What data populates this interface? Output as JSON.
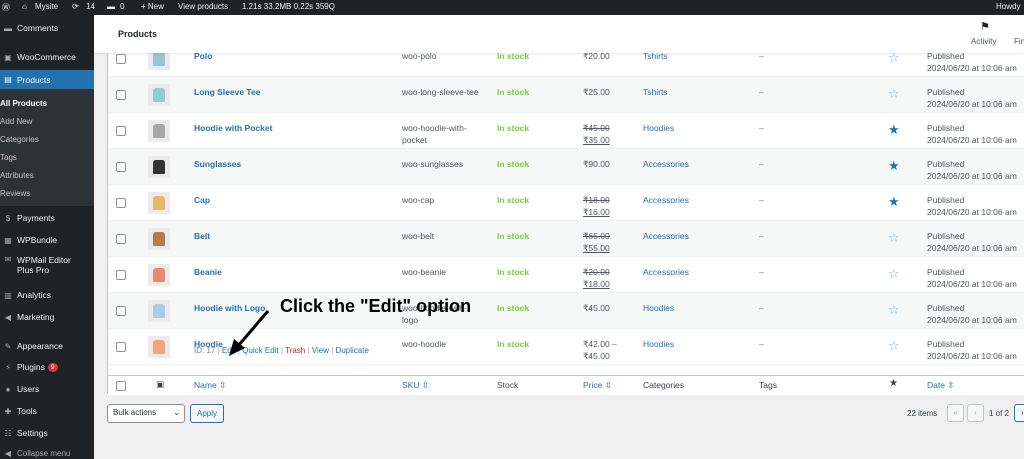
{
  "admin_bar": {
    "site_name": "Mysite",
    "updates_count": "14",
    "comments_count": "0",
    "new_label": "+ New",
    "view_products": "View products",
    "stats": "1.21s  33.2MB  0.22s  359Q",
    "howdy": "Howdy"
  },
  "sidebar": {
    "comments": "Comments",
    "woocommerce": "WooCommerce",
    "products": "Products",
    "sub_items": [
      "All Products",
      "Add New",
      "Categories",
      "Tags",
      "Attributes",
      "Reviews"
    ],
    "payments": "Payments",
    "wpbundle": "WPBundle",
    "wpmail_line1": "WPMail Editor",
    "wpmail_line2": "Plus Pro",
    "analytics": "Analytics",
    "marketing": "Marketing",
    "appearance": "Appearance",
    "plugins": "Plugins",
    "plugins_badge": "9",
    "users": "Users",
    "tools": "Tools",
    "settings": "Settings",
    "collapse": "Collapse menu"
  },
  "header": {
    "title": "Products",
    "activity": "Activity",
    "finish": "Fin"
  },
  "rows": [
    {
      "name": "Polo",
      "sku": "woo-polo",
      "stock": "In stock",
      "price_old": "",
      "price": "₹20.00",
      "category": "Tshirts",
      "tags": "–",
      "featured": false,
      "status": "Published",
      "date": "2024/06/20 at 10:06 am",
      "color": "#9cc3d8"
    },
    {
      "name": "Long Sleeve Tee",
      "sku": "woo-long-sleeve-tee",
      "stock": "In stock",
      "price_old": "",
      "price": "₹25.00",
      "category": "Tshirts",
      "tags": "–",
      "featured": false,
      "status": "Published",
      "date": "2024/06/20 at 10:06 am",
      "color": "#8fd0c2"
    },
    {
      "name": "Hoodie with Pocket",
      "sku": "woo-hoodie-with-pocket",
      "stock": "In stock",
      "price_old": "₹45.00",
      "price": "₹35.00",
      "category": "Hoodies",
      "tags": "–",
      "featured": true,
      "status": "Published",
      "date": "2024/06/20 at 10:06 am",
      "color": "#a8a8a8"
    },
    {
      "name": "Sunglasses",
      "sku": "woo-sunglasses",
      "stock": "In stock",
      "price_old": "",
      "price": "₹90.00",
      "category": "Accessories",
      "tags": "–",
      "featured": true,
      "status": "Published",
      "date": "2024/06/20 at 10:06 am",
      "color": "#333333"
    },
    {
      "name": "Cap",
      "sku": "woo-cap",
      "stock": "In stock",
      "price_old": "₹18.00",
      "price": "₹16.00",
      "category": "Accessories",
      "tags": "–",
      "featured": true,
      "status": "Published",
      "date": "2024/06/20 at 10:06 am",
      "color": "#e8b86a"
    },
    {
      "name": "Belt",
      "sku": "woo-belt",
      "stock": "In stock",
      "price_old": "₹65.00",
      "price": "₹55.00",
      "category": "Accessories",
      "tags": "–",
      "featured": false,
      "status": "Published",
      "date": "2024/06/20 at 10:06 am",
      "color": "#b87a4b"
    },
    {
      "name": "Beanie",
      "sku": "woo-beanie",
      "stock": "In stock",
      "price_old": "₹20.00",
      "price": "₹18.00",
      "category": "Accessories",
      "tags": "–",
      "featured": false,
      "status": "Published",
      "date": "2024/06/20 at 10:06 am",
      "color": "#e88a72"
    },
    {
      "name": "Hoodie with Logo",
      "sku": "woo-hoodie-with-logo",
      "stock": "In stock",
      "price_old": "",
      "price": "₹45.00",
      "category": "Hoodies",
      "tags": "–",
      "featured": false,
      "status": "Published",
      "date": "2024/06/20 at 10:06 am",
      "color": "#a9cde6"
    },
    {
      "name": "Hoodie",
      "sku": "woo-hoodie",
      "stock": "In stock",
      "price_old": "",
      "price": "₹42.00 –\n₹45.00",
      "category": "Hoodies",
      "tags": "–",
      "featured": false,
      "status": "Published",
      "date": "2024/06/20 at 10:06 am",
      "color": "#f2a57a"
    }
  ],
  "row_actions": {
    "id": "ID: 17",
    "edit": "Edit",
    "quick_edit": "Quick Edit",
    "trash": "Trash",
    "view": "View",
    "duplicate": "Duplicate"
  },
  "footer": {
    "name": "Name",
    "sku": "SKU",
    "stock": "Stock",
    "price": "Price",
    "categories": "Categories",
    "tags": "Tags",
    "date": "Date"
  },
  "bulk_actions": "Bulk actions",
  "apply": "Apply",
  "pagination": {
    "items": "22 items",
    "first": "«",
    "prev": "‹",
    "page_info": "1 of 2",
    "next": "›"
  },
  "annotation": "Click the \"Edit\" option",
  "colors": {
    "link": "#2271b1",
    "instock": "#7ad03a",
    "trash": "#b32d2e",
    "sidebar": "#1d2327",
    "active": "#2271b1"
  }
}
